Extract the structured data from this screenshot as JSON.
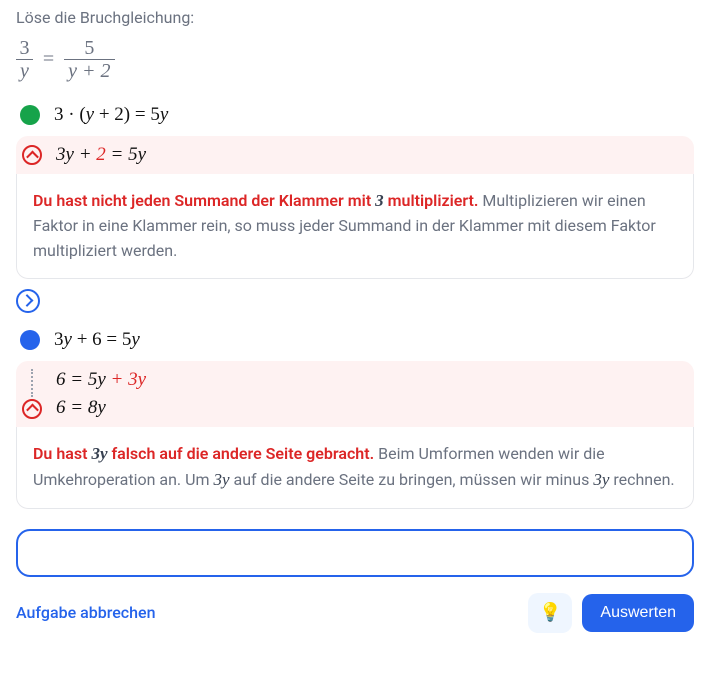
{
  "prompt": "Löse die Bruchgleichung:",
  "equation": {
    "left_num": "3",
    "left_den": "y",
    "eq": "=",
    "right_num": "5",
    "right_den": "y + 2"
  },
  "step1": {
    "pre": "3 · (",
    "mid": "y",
    "post": " + 2) = 5",
    "end": "y"
  },
  "err1": {
    "line_a": "3",
    "line_b": "y",
    "line_c": " + ",
    "line_hl": "2",
    "line_d": " = 5",
    "line_e": "y",
    "lead": "Du hast nicht jeden Summand der Klammer mit ",
    "lead_m": "3",
    "lead2": " multipliziert.",
    "rest": " Multiplizieren wir einen Faktor in eine Klammer rein, so muss jeder Summand in der Klammer mit diesem Faktor multipliziert werden."
  },
  "step2": {
    "a": "3",
    "b": "y",
    "c": " + 6 = 5",
    "d": "y"
  },
  "err2": {
    "l1_a": "6 = 5",
    "l1_b": "y",
    "l1_c": " + 3",
    "l1_d": "y",
    "l2_a": "6 = 8",
    "l2_b": "y",
    "lead": "Du hast ",
    "lead_m1": "3",
    "lead_m2": "y",
    "lead2": " falsch auf die andere Seite gebracht.",
    "rest1": " Beim Umformen wenden wir die Umkehroperation an. Um ",
    "rest_m1": "3",
    "rest_m2": "y",
    "rest2": " auf die andere Seite zu bringen, müssen wir minus ",
    "rest_m3": "3",
    "rest_m4": "y",
    "rest3": " rechnen."
  },
  "actions": {
    "cancel": "Aufgabe abbrechen",
    "evaluate": "Auswerten",
    "hint_icon": "💡"
  }
}
